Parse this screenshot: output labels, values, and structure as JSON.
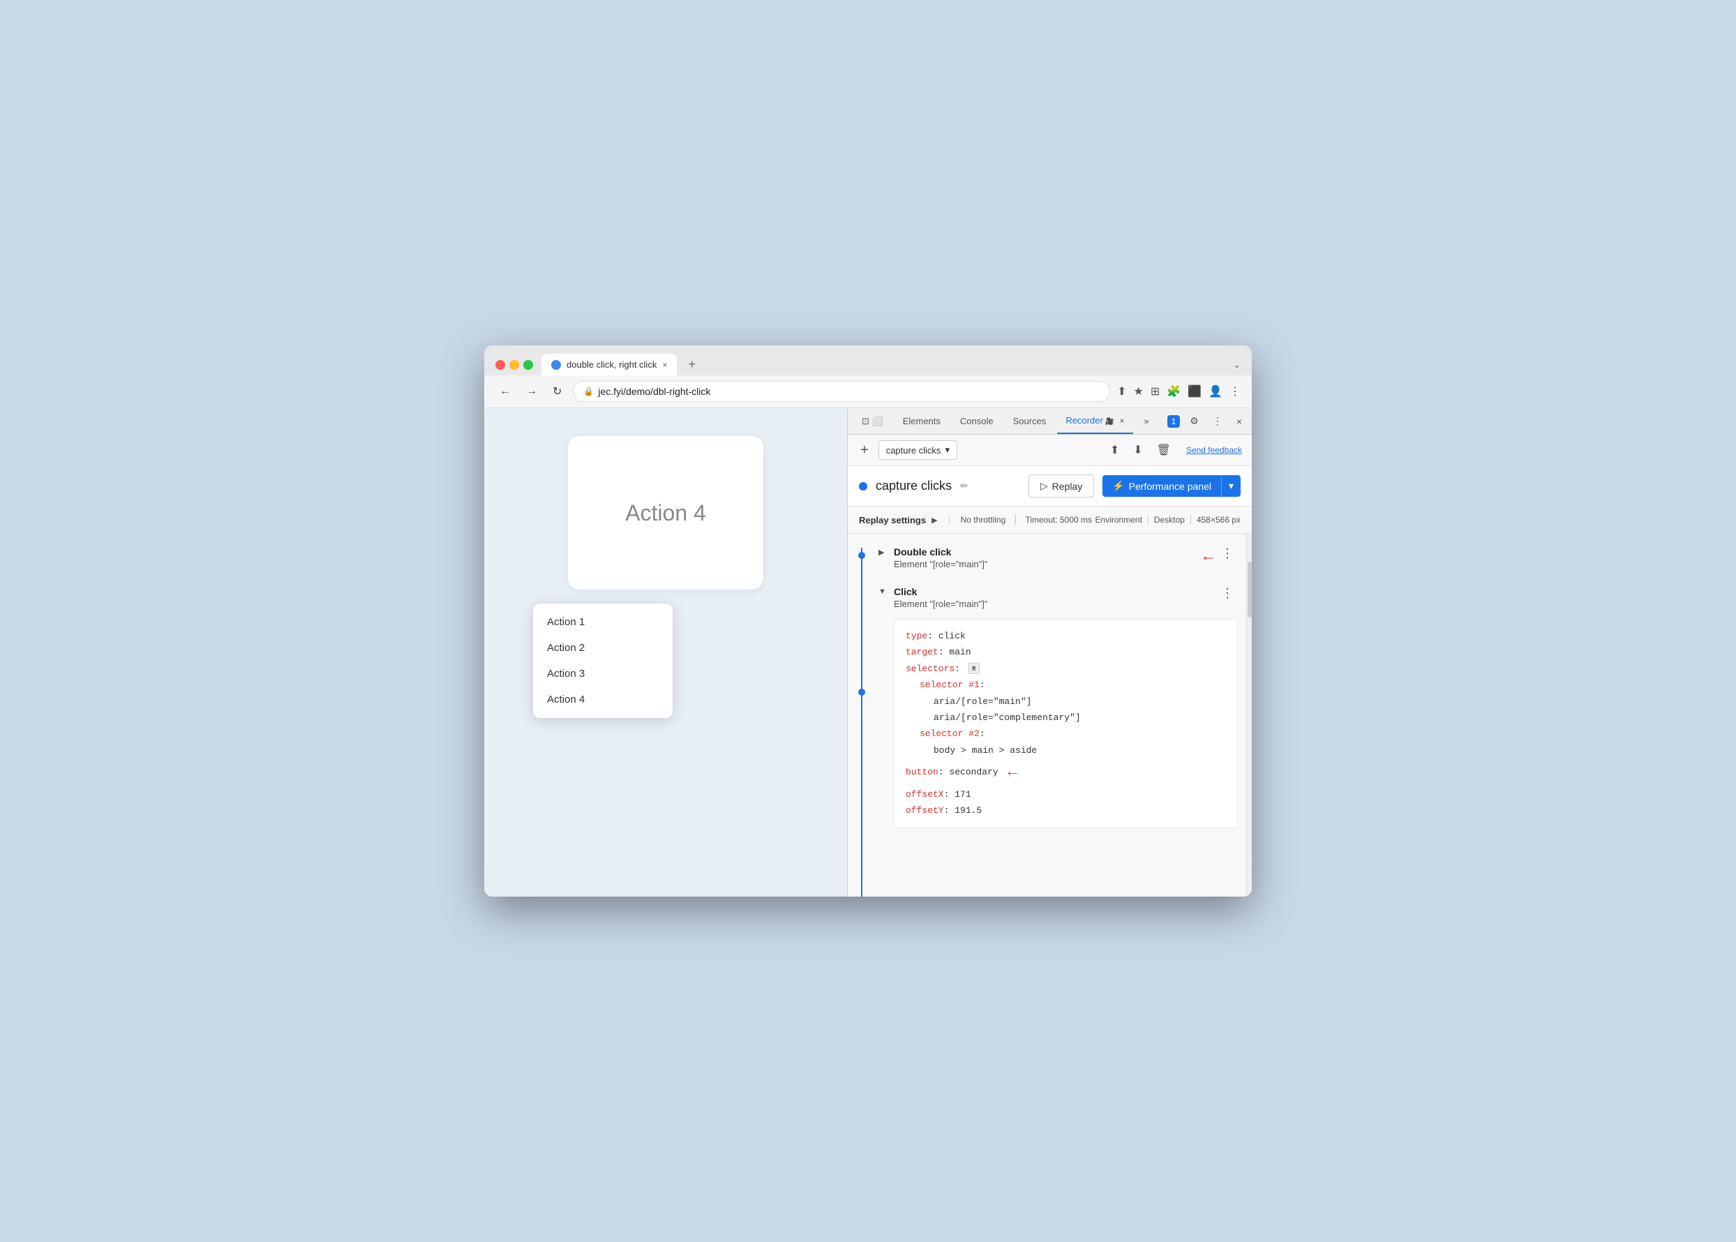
{
  "browser": {
    "tab_title": "double click, right click",
    "tab_new_label": "+",
    "address": "jec.fyi/demo/dbl-right-click",
    "window_control_chevron": "⌄"
  },
  "nav": {
    "back": "←",
    "forward": "→",
    "refresh": "↻",
    "share_icon": "⬆",
    "bookmark_icon": "★",
    "extension_icon": "⊞",
    "profile_icon": "◉",
    "more_icon": "⋮"
  },
  "webpage": {
    "action4_label": "Action 4",
    "menu_items": [
      "Action 1",
      "Action 2",
      "Action 3",
      "Action 4"
    ]
  },
  "devtools": {
    "tabs": [
      "Elements",
      "Console",
      "Sources",
      "Recorder",
      ""
    ],
    "recorder_tab_label": "Recorder",
    "tab_close": "×",
    "tab_more": "»",
    "badge_label": "1",
    "settings_icon": "⚙",
    "more_icon": "⋮",
    "close_icon": "×",
    "inspect_icon": "⊡",
    "device_icon": "⬜"
  },
  "recorder_toolbar": {
    "add_label": "+",
    "recording_name": "capture clicks",
    "dropdown_arrow": "▾",
    "export_icon": "⬆",
    "import_icon": "⬇",
    "delete_icon": "🗑",
    "send_feedback_label": "Send feedback"
  },
  "recording_header": {
    "title": "capture clicks",
    "edit_icon": "✏",
    "replay_label": "Replay",
    "replay_play_icon": "▷",
    "performance_panel_label": "Performance panel",
    "perf_icon": "⚡",
    "dropdown_arrow": "▾"
  },
  "replay_settings": {
    "title": "Replay settings",
    "expand_icon": "▶",
    "no_throttling_label": "No throttling",
    "timeout_label": "Timeout: 5000 ms",
    "environment_label": "Environment",
    "desktop_label": "Desktop",
    "dimensions_label": "458×566 px"
  },
  "steps": [
    {
      "id": 1,
      "title": "Double click",
      "element": "Element \"[role=\"main\"]\"",
      "expanded": false,
      "show_arrow": true
    },
    {
      "id": 2,
      "title": "Click",
      "element": "Element \"[role=\"main\"]\"",
      "expanded": true,
      "show_arrow": false
    }
  ],
  "code": {
    "lines": [
      {
        "indent": 0,
        "key": "type",
        "colon": ": ",
        "value": "click"
      },
      {
        "indent": 0,
        "key": "target",
        "colon": ": ",
        "value": "main"
      },
      {
        "indent": 0,
        "key": "selectors",
        "colon": ": ",
        "value": "",
        "has_icon": true
      },
      {
        "indent": 1,
        "key": "selector #1",
        "colon": ":",
        "value": ""
      },
      {
        "indent": 2,
        "key": "",
        "colon": "",
        "value": "aria/[role=\"main\"]"
      },
      {
        "indent": 2,
        "key": "",
        "colon": "",
        "value": "aria/[role=\"complementary\"]"
      },
      {
        "indent": 1,
        "key": "selector #2",
        "colon": ":",
        "value": ""
      },
      {
        "indent": 2,
        "key": "",
        "colon": "",
        "value": "body > main > aside"
      },
      {
        "indent": 0,
        "key": "button",
        "colon": ": ",
        "value": "secondary",
        "has_arrow": true
      },
      {
        "indent": 0,
        "key": "offsetX",
        "colon": ": ",
        "value": "171"
      },
      {
        "indent": 0,
        "key": "offsetY",
        "colon": ": ",
        "value": "191.5"
      }
    ]
  }
}
